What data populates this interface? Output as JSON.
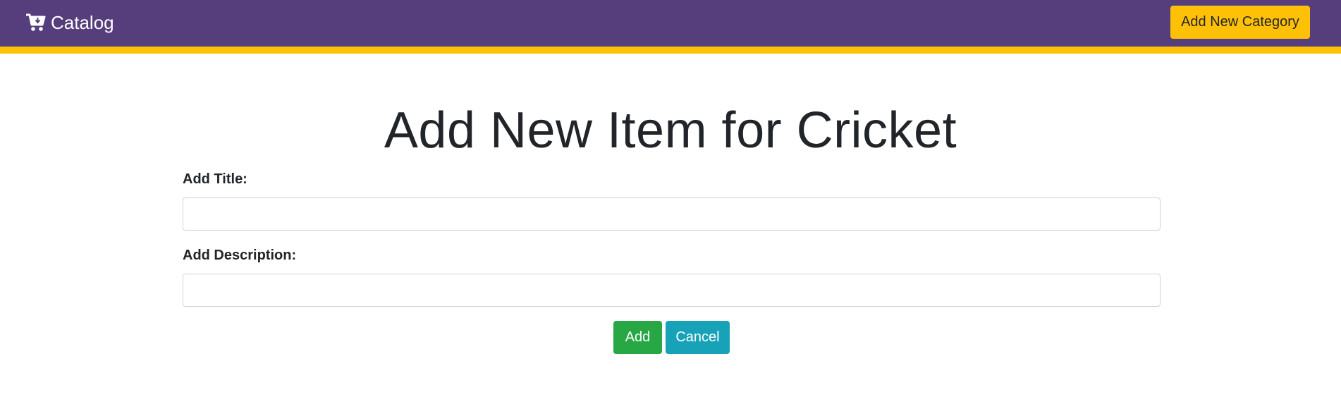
{
  "navbar": {
    "brand_icon": "cart-arrow-down-icon",
    "brand_label": "Catalog",
    "add_category_label": "Add New Category",
    "background_color": "#563d7c",
    "accent_color": "#ffc107"
  },
  "main": {
    "title": "Add New Item for Cricket",
    "title_field": {
      "label": "Add Title:",
      "value": "",
      "placeholder": ""
    },
    "description_field": {
      "label": "Add Description:",
      "value": "",
      "placeholder": ""
    },
    "add_button_label": "Add",
    "cancel_button_label": "Cancel",
    "add_button_color": "#28a745",
    "cancel_button_color": "#17a2b8"
  }
}
